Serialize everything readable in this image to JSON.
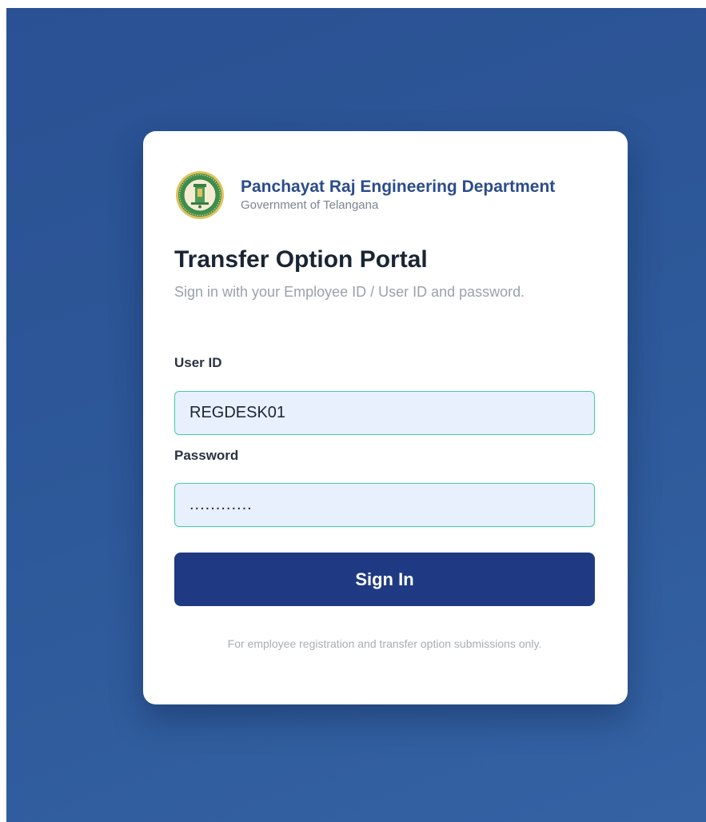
{
  "brand": {
    "department": "Panchayat Raj Engineering Department",
    "government": "Government of Telangana",
    "emblem_icon": "telangana-state-emblem"
  },
  "login": {
    "title": "Transfer Option Portal",
    "subtitle": "Sign in with your Employee ID / User ID and password.",
    "user_id_label": "User ID",
    "user_id_value": "REGDESK01",
    "password_label": "Password",
    "password_value": "............",
    "sign_in_label": "Sign In",
    "footnote": "For employee registration and transfer option submissions only."
  },
  "colors": {
    "background": "#2d5899",
    "primary_button": "#1f3a82",
    "input_border": "#3fd0a0",
    "input_fill": "#e8f0fe",
    "brand_text": "#2b4c8c"
  }
}
